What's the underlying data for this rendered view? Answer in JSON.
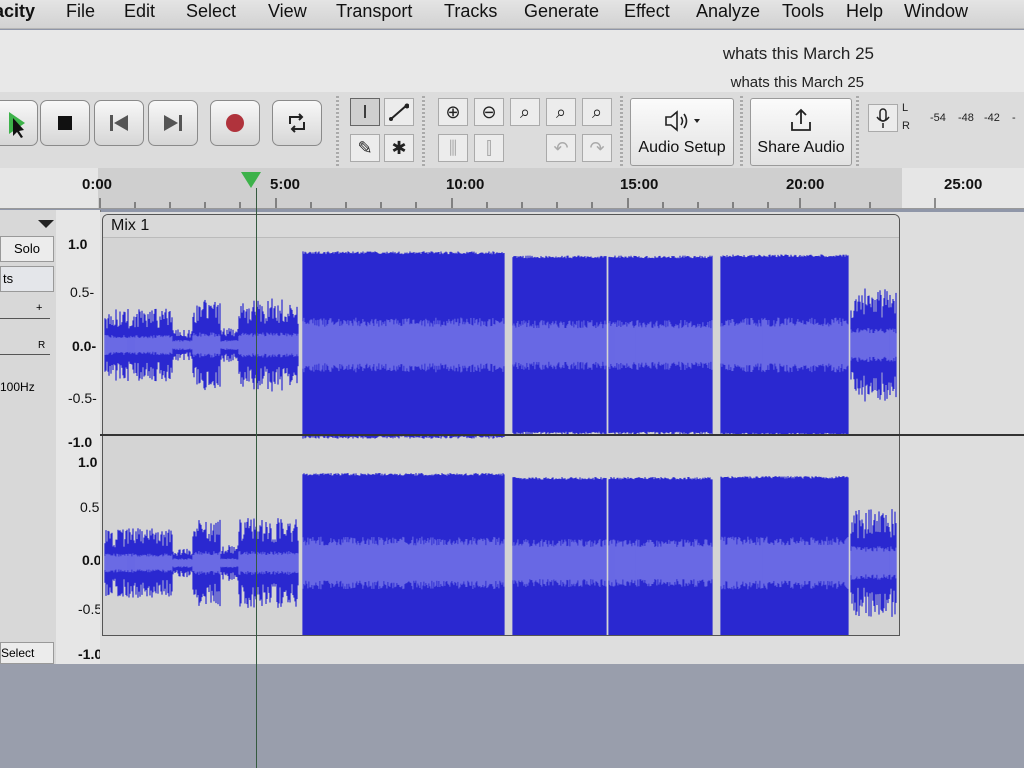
{
  "menu": [
    "acity",
    "File",
    "Edit",
    "Select",
    "View",
    "Transport",
    "Tracks",
    "Generate",
    "Effect",
    "Analyze",
    "Tools",
    "Help",
    "Window"
  ],
  "window_title": "whats this March 25",
  "window_title_secondary": "whats this March 25",
  "toolbar": {
    "audio_setup_label": "Audio Setup",
    "share_audio_label": "Share Audio",
    "meter_l": "L",
    "meter_r": "R",
    "meter_ticks": [
      "-54",
      "-48",
      "-42",
      "-"
    ]
  },
  "timeline": {
    "labels": [
      "0:00",
      "5:00",
      "10:00",
      "15:00",
      "20:00",
      "25:00"
    ]
  },
  "track": {
    "clip_name": "Mix 1",
    "solo_label": "Solo",
    "mute_partial": "ts",
    "pan_r": "R",
    "plus": "+",
    "rate": "100Hz",
    "select_label": "Select",
    "vruler_top": [
      "1.0",
      "0.5-",
      "0.0-",
      "-0.5-",
      "-1.0"
    ],
    "vruler_bottom": [
      "1.0",
      "0.5-",
      "0.0-",
      "-0.5-",
      "-1.0"
    ]
  },
  "colors": {
    "waveform_dark": "#2a29d0",
    "waveform_rms": "#6f6fe6",
    "play_green": "#3db24a"
  }
}
